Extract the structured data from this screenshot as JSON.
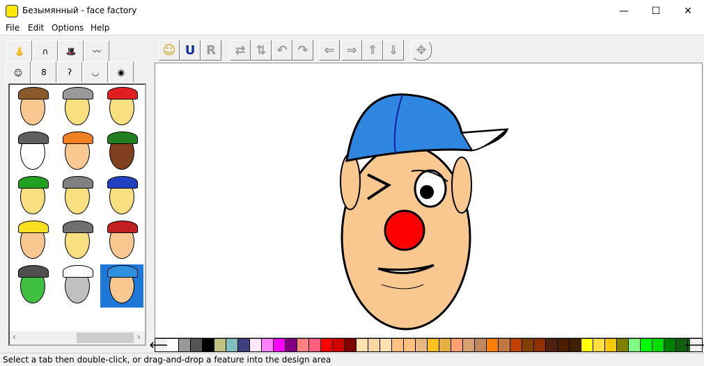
{
  "window": {
    "title": "Безымянный - face factory",
    "minimize": "—",
    "maximize": "☐",
    "close": "✕"
  },
  "menu": [
    "File",
    "Edit",
    "Options",
    "Help"
  ],
  "tabs_row1": [
    {
      "name": "nose",
      "glyph": "👃"
    },
    {
      "name": "hair",
      "glyph": "∩"
    },
    {
      "name": "hat",
      "glyph": "🎩"
    },
    {
      "name": "moustache",
      "glyph": "〰"
    }
  ],
  "tabs_row2": [
    {
      "name": "face",
      "glyph": "☺"
    },
    {
      "name": "head-shape",
      "glyph": "8"
    },
    {
      "name": "ear",
      "glyph": "ʔ"
    },
    {
      "name": "lips",
      "glyph": "◡"
    },
    {
      "name": "eye",
      "glyph": "◉"
    }
  ],
  "toolbar": [
    {
      "name": "new-face",
      "glyph": "☺",
      "enabled": true
    },
    {
      "name": "undo",
      "glyph": "U",
      "enabled": true
    },
    {
      "name": "redo",
      "glyph": "R",
      "enabled": false
    },
    {
      "name": "flip-horizontal",
      "glyph": "⇄",
      "enabled": false
    },
    {
      "name": "flip-vertical",
      "glyph": "⇅",
      "enabled": false
    },
    {
      "name": "rotate-left",
      "glyph": "↶",
      "enabled": false
    },
    {
      "name": "rotate-right",
      "glyph": "↷",
      "enabled": false
    },
    {
      "name": "stretch-left",
      "glyph": "⇐",
      "enabled": false
    },
    {
      "name": "stretch-right",
      "glyph": "⇒",
      "enabled": false
    },
    {
      "name": "stretch-up",
      "glyph": "⇑",
      "enabled": false
    },
    {
      "name": "stretch-down",
      "glyph": "⇓",
      "enabled": false
    },
    {
      "name": "move",
      "glyph": "✥",
      "enabled": false
    }
  ],
  "thumbnails": [
    {
      "hat": "#8b5a2b",
      "skin": "#f8c890"
    },
    {
      "hat": "#999999",
      "skin": "#f8e080"
    },
    {
      "hat": "#e02020",
      "skin": "#f8e080"
    },
    {
      "hat": "#606060",
      "skin": "#ffffff"
    },
    {
      "hat": "#f08020",
      "skin": "#f8c890"
    },
    {
      "hat": "#208020",
      "skin": "#804020"
    },
    {
      "hat": "#20a020",
      "skin": "#f8e080"
    },
    {
      "hat": "#808080",
      "skin": "#f8e080"
    },
    {
      "hat": "#2040c0",
      "skin": "#f8e080"
    },
    {
      "hat": "#f8e020",
      "skin": "#f8c890"
    },
    {
      "hat": "#707070",
      "skin": "#f8e080"
    },
    {
      "hat": "#c02020",
      "skin": "#f8c890"
    },
    {
      "hat": "#505050",
      "skin": "#40c040"
    },
    {
      "hat": "#ffffff",
      "skin": "#c0c0c0"
    },
    {
      "hat": "#3090e0",
      "skin": "#f8c890",
      "selected": true
    }
  ],
  "palette": [
    "#ffffff",
    "#999999",
    "#555555",
    "#000000",
    "#c0c080",
    "#80c0c0",
    "#404080",
    "#ffe8ff",
    "#ff80ff",
    "#ff00ff",
    "#800080",
    "#ff8080",
    "#ff6080",
    "#ff0000",
    "#d00000",
    "#800000",
    "#ffe0b0",
    "#ffd8a0",
    "#ffe0b0",
    "#ffc080",
    "#ffc080",
    "#e8b880",
    "#ffc020",
    "#e8b040",
    "#ffa070",
    "#d8a070",
    "#c08860",
    "#ff8000",
    "#c07840",
    "#c04000",
    "#804000",
    "#903000",
    "#502010",
    "#482000",
    "#402000",
    "#ffff00",
    "#ffe040",
    "#f8c800",
    "#808000",
    "#80ff80",
    "#00ff00",
    "#00e000",
    "#008000",
    "#106010"
  ],
  "palette_left": "🡐",
  "palette_right": "🡒",
  "scroll_left": "‹",
  "scroll_right": "›",
  "status": "Select a tab then double-click, or drag-and-drop a feature into the design area"
}
